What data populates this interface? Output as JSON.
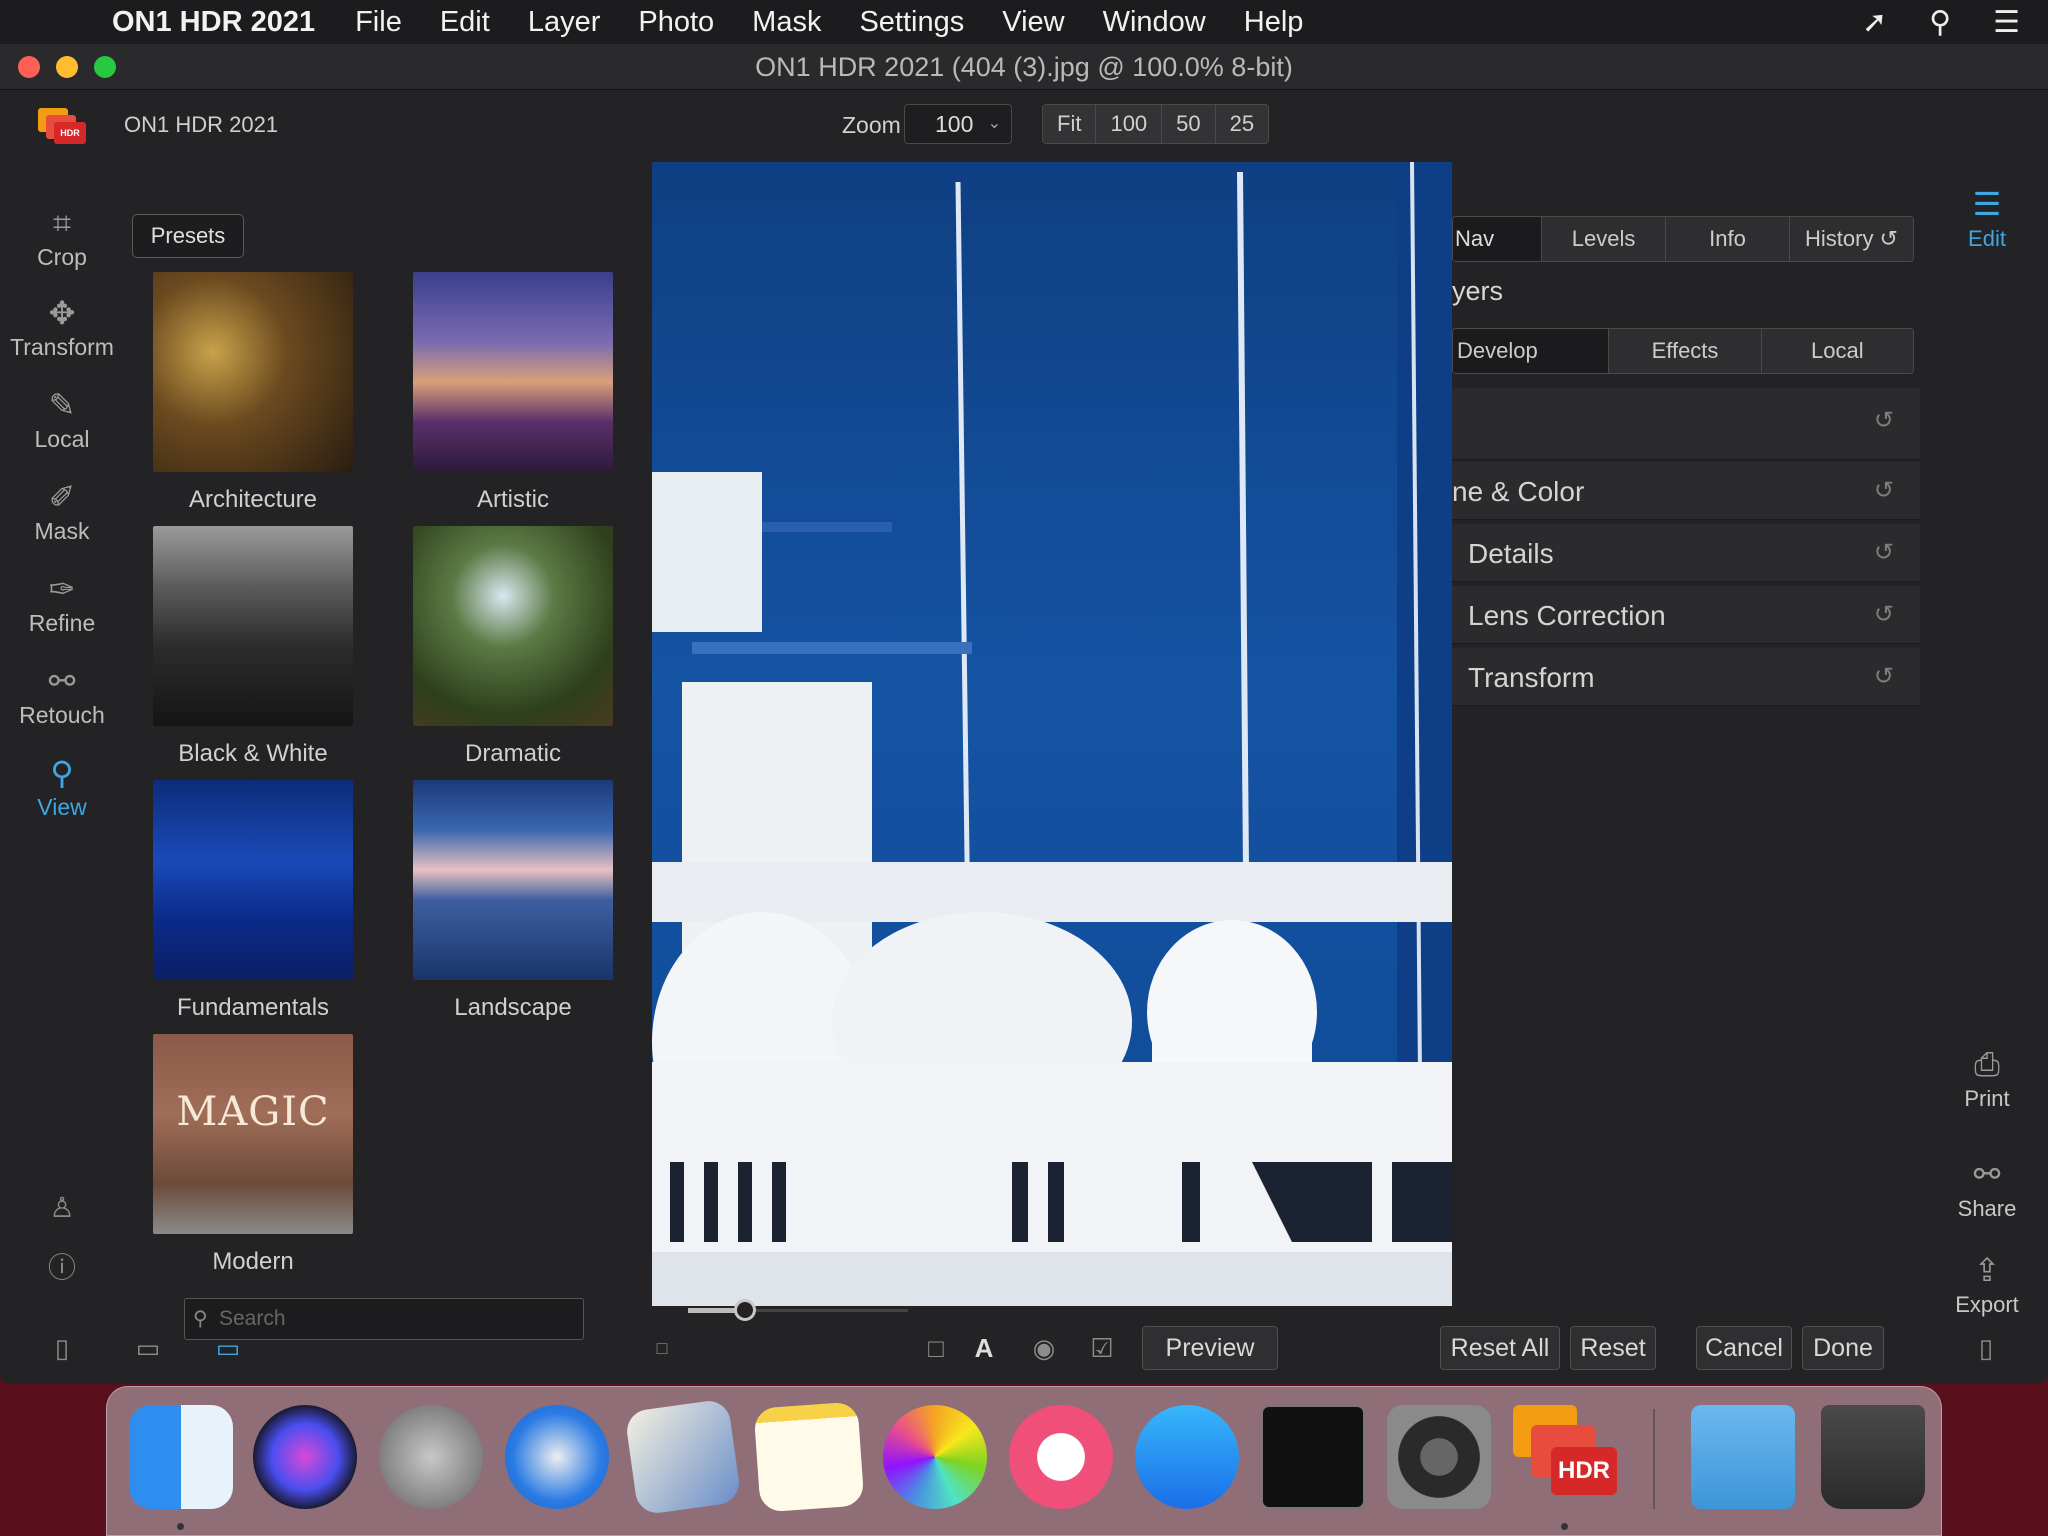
{
  "menubar": {
    "apple_icon": "apple-icon",
    "app_name": "ON1 HDR 2021",
    "items": [
      "File",
      "Edit",
      "Layer",
      "Photo",
      "Mask",
      "Settings",
      "View",
      "Window",
      "Help"
    ],
    "right_icons": [
      "share-arrow-icon",
      "search-icon",
      "list-icon"
    ]
  },
  "window": {
    "title": "ON1 HDR 2021 (404 (3).jpg @ 100.0% 8-bit)"
  },
  "appbar": {
    "logo_text": "HDR",
    "title": "ON1 HDR 2021",
    "zoom_label": "Zoom",
    "zoom_value": "100",
    "zoom_buttons": [
      "Fit",
      "100",
      "50",
      "25"
    ]
  },
  "left_tools": [
    {
      "label": "Crop",
      "icon": "crop-icon",
      "glyph": "⌗"
    },
    {
      "label": "Transform",
      "icon": "move-icon",
      "glyph": "✥"
    },
    {
      "label": "Local",
      "icon": "brush-icon",
      "glyph": "✎"
    },
    {
      "label": "Mask",
      "icon": "mask-brush-icon",
      "glyph": "✐"
    },
    {
      "label": "Refine",
      "icon": "refine-brush-icon",
      "glyph": "✑"
    },
    {
      "label": "Retouch",
      "icon": "retouch-icon",
      "glyph": "⚯"
    },
    {
      "label": "View",
      "icon": "view-hand-icon",
      "glyph": "⚲"
    }
  ],
  "presets": {
    "button_label": "Presets",
    "categories": [
      "Architecture",
      "Artistic",
      "Black & White",
      "Dramatic",
      "Fundamentals",
      "Landscape",
      "Modern"
    ],
    "modern_thumb_text": "MAGIC",
    "search_placeholder": "Search"
  },
  "right_panel": {
    "top_tabs": [
      "Nav",
      "Levels",
      "Info",
      "History ↺"
    ],
    "layers_heading": "yers",
    "mode_tabs": [
      "Develop",
      "Effects",
      "Local"
    ],
    "sections": [
      "",
      "ne & Color",
      "Details",
      "Lens Correction",
      "Transform"
    ],
    "reset_glyph": "↺"
  },
  "right_tools": [
    {
      "label": "Edit",
      "icon": "sliders-icon",
      "glyph": "☰"
    },
    {
      "label": "Print",
      "icon": "printer-icon",
      "glyph": "⎙"
    },
    {
      "label": "Share",
      "icon": "share-icon",
      "glyph": "⚯"
    },
    {
      "label": "Export",
      "icon": "export-icon",
      "glyph": "⇪"
    }
  ],
  "bottombar": {
    "preview": "Preview",
    "reset_all": "Reset All",
    "reset": "Reset",
    "cancel": "Cancel",
    "done": "Done",
    "text_overlay_glyph": "A"
  },
  "dock": {
    "apps": [
      "Finder",
      "Siri",
      "Launchpad",
      "Safari",
      "Mail",
      "Notes",
      "Photos",
      "Music",
      "App Store",
      "Terminal",
      "System Preferences",
      "ON1 HDR",
      "Downloads",
      "Trash"
    ],
    "hdr_label": "HDR"
  },
  "colors": {
    "accent": "#3ea6e0",
    "window_bg": "#232325",
    "desktop": "#5a0f1c"
  }
}
